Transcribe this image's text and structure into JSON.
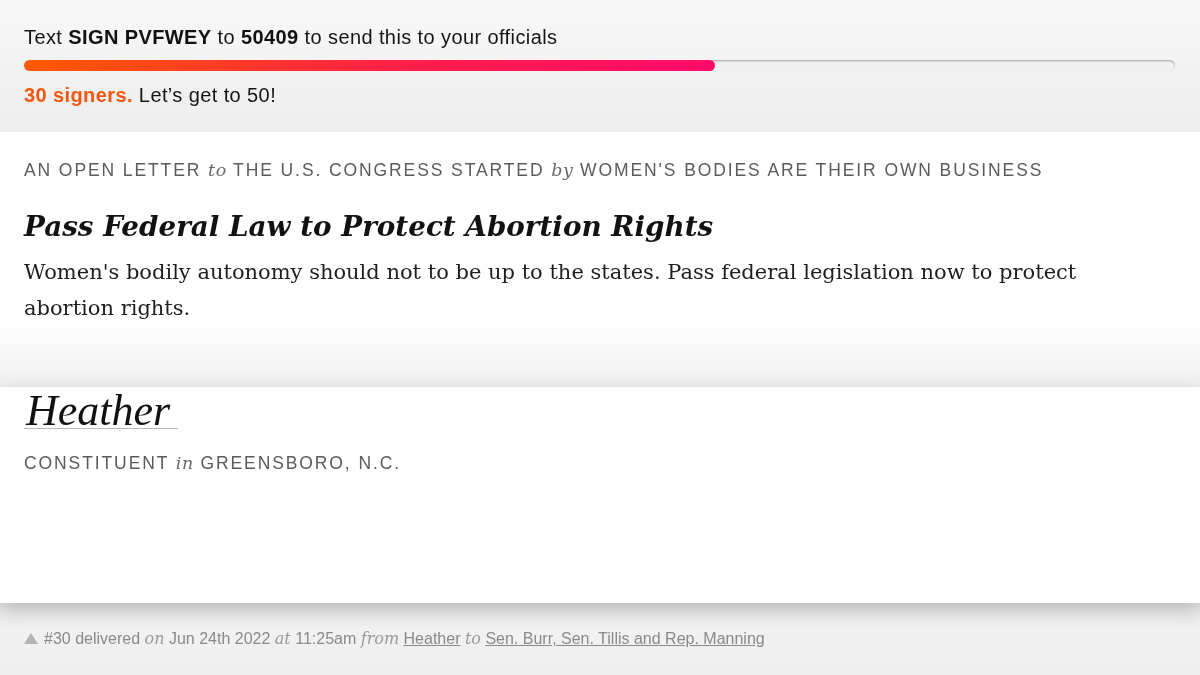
{
  "sms_prompt": "Text **SIGN PVFWEY** to **50409** to send this to your officials",
  "progress": {
    "level": 0.6,
    "caption": "**30 signers.** Let’s get to 50!"
  },
  "letter": {
    "byline": "AN OPEN LETTER *to* THE U.S. CONGRESS STARTED *by* WOMEN'S BODIES ARE THEIR OWN BUSINESS",
    "title": "Pass Federal Law to Protect Abortion Rights",
    "body": "Women's bodily autonomy should not to be up to the states. Pass federal legislation now to protect abortion rights."
  },
  "signer": {
    "signature": "Heather",
    "role": "CONSTITUENT *in* GREENSBORO, N.C."
  },
  "delivery": {
    "summary": "#30 delivered *on* Jun 24th 2022 *at* 11:25am *from*",
    "sender": "Heather",
    "to_word": "to",
    "recipients": "Sen. Burr, Sen. Tillis and Rep. Manning"
  }
}
